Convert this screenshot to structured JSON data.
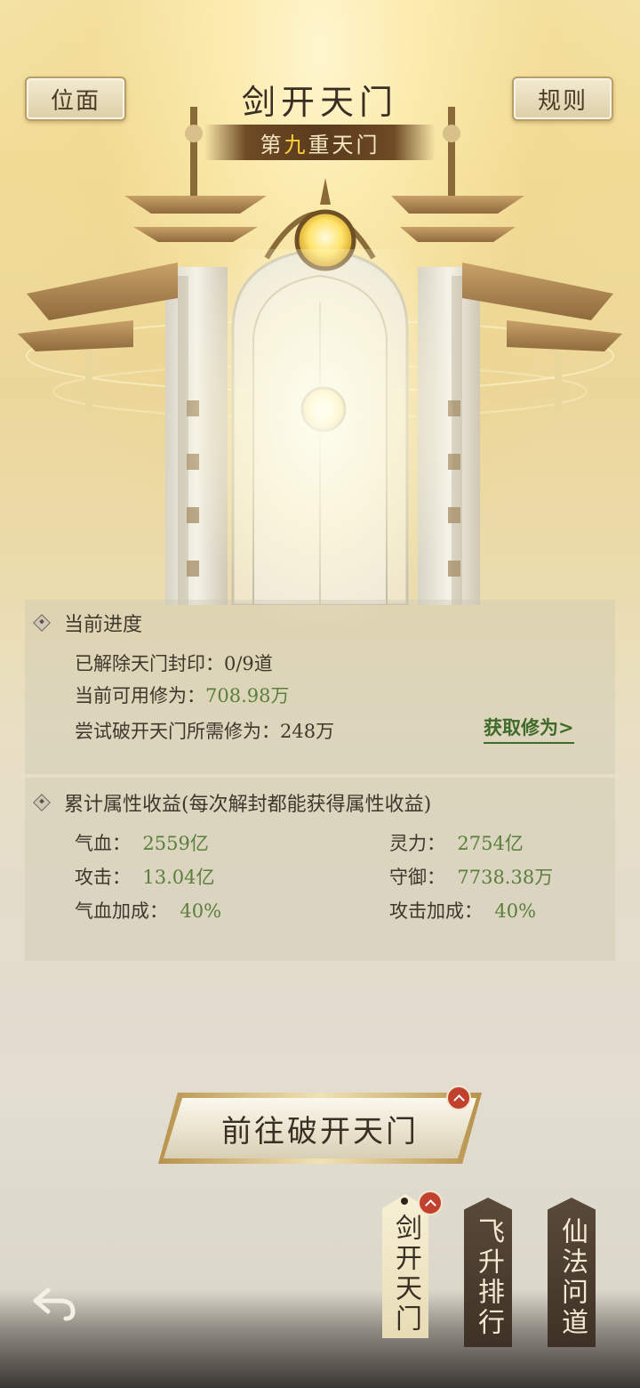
{
  "header": {
    "left_button": "位面",
    "right_button": "规则",
    "title": "剑开天门",
    "subtitle_prefix": "第",
    "subtitle_highlight": "九",
    "subtitle_suffix": "重天门"
  },
  "progress": {
    "section_title": "当前进度",
    "seal_label": "已解除天门封印：",
    "seal_value": "0/9道",
    "available_label": "当前可用修为：",
    "available_value": "708.98万",
    "required_label": "尝试破开天门所需修为：",
    "required_value": "248万",
    "get_link": "获取修为>"
  },
  "attributes": {
    "section_title": "累计属性收益(每次解封都能获得属性收益)",
    "items": [
      {
        "label": "气血：",
        "value": "2559亿"
      },
      {
        "label": "灵力：",
        "value": "2754亿"
      },
      {
        "label": "攻击：",
        "value": "13.04亿"
      },
      {
        "label": "守御：",
        "value": "7738.38万"
      },
      {
        "label": "气血加成：",
        "value": "40%"
      },
      {
        "label": "攻击加成：",
        "value": "40%"
      }
    ]
  },
  "actions": {
    "main_button": "前往破开天门"
  },
  "tabs": [
    {
      "label": "剑开天门"
    },
    {
      "label": "飞升排行"
    },
    {
      "label": "仙法问道"
    }
  ],
  "colors": {
    "accent_green": "#5b7f3c",
    "badge_red": "#c2402e",
    "title_brown": "#3a2e22"
  }
}
